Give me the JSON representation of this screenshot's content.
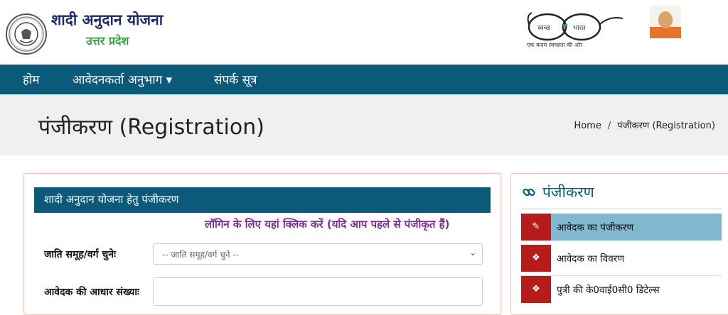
{
  "header": {
    "title": "शादी अनुदान योजना",
    "subtitle": "उत्तर प्रदेश",
    "swachh_tagline": "एक कदम स्वच्छता की ओर",
    "swachh_left": "स्वच्छ",
    "swachh_right": "भारत"
  },
  "nav": {
    "items": [
      {
        "label": "होम"
      },
      {
        "label": "आवेदनकर्ता अनुभाग ▾"
      },
      {
        "label": "संपर्क सूत्र"
      }
    ]
  },
  "banner": {
    "page_title": "पंजीकरण (Registration)",
    "breadcrumb_home": "Home",
    "breadcrumb_sep": "/",
    "breadcrumb_current": "पंजीकरण (Registration)"
  },
  "form": {
    "heading": "शादी अनुदान योजना हेतु पंजीकरण",
    "login_link": "लॉगिन के लिए यहां क्लिक करें (यदि आप पहले से पंजीकृत हैं)",
    "caste_label": "जाति समूह/वर्ग चुनेः",
    "caste_placeholder": "-- जाति समूह/वर्ग चुने --",
    "aadhaar_label": "आवेदक की आधार संख्याः"
  },
  "sidebar": {
    "title": "पंजीकरण",
    "items": [
      {
        "label": "आवेदक का पंजीकरण"
      },
      {
        "label": "आवेदक का विवरण"
      },
      {
        "label": "पुत्री की के0वाई0सी0 डिटेल्स"
      }
    ]
  },
  "colors": {
    "nav_bg": "#0b5a7a",
    "title_blue": "#1d2a6c",
    "subtitle_green": "#37a14a",
    "login_purple": "#7a2d91",
    "icon_red": "#b71c1c",
    "active_item": "#7fb8cf"
  }
}
